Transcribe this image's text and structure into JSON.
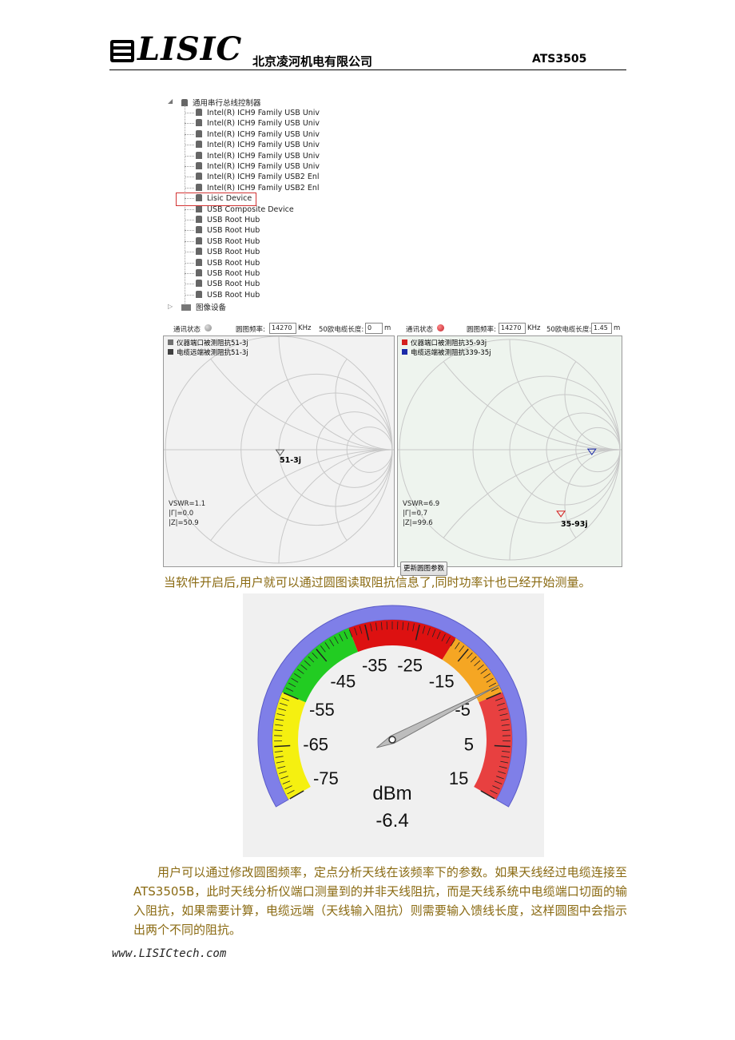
{
  "header": {
    "logo_text": "LISIC",
    "company": "北京凌河机电有限公司",
    "model": "ATS3505"
  },
  "device_tree": {
    "root_label": "通用串行总线控制器",
    "items": [
      "Intel(R) ICH9 Family USB Univ",
      "Intel(R) ICH9 Family USB Univ",
      "Intel(R) ICH9 Family USB Univ",
      "Intel(R) ICH9 Family USB Univ",
      "Intel(R) ICH9 Family USB Univ",
      "Intel(R) ICH9 Family USB Univ",
      "Intel(R) ICH9 Family USB2 Enl",
      "Intel(R) ICH9 Family USB2 Enl",
      "Lisic Device",
      "USB Composite Device",
      "USB Root Hub",
      "USB Root Hub",
      "USB Root Hub",
      "USB Root Hub",
      "USB Root Hub",
      "USB Root Hub",
      "USB Root Hub",
      "USB Root Hub"
    ],
    "selected_item": "Lisic Device",
    "next_group": "图像设备"
  },
  "smith_left": {
    "status_label": "通讯状态",
    "status_color": "#888888",
    "freq_label": "圆图频率:",
    "freq_value": "14270",
    "freq_unit": "KHz",
    "cable_label": "50欧电缆长度:",
    "cable_value": "0",
    "cable_unit": "m",
    "legend": [
      {
        "text": "仪器端口被测阻抗51-3j",
        "color": "#707070"
      },
      {
        "text": "电缆远端被测阻抗51-3j",
        "color": "#404040"
      }
    ],
    "marker_label": "51-3j",
    "vswr": "VSWR=1.1",
    "gamma": "|Γ|=0.0",
    "z": "|Z|=50.9"
  },
  "smith_right": {
    "status_label": "通讯状态",
    "status_color": "#c0202a",
    "freq_label": "圆图频率:",
    "freq_value": "14270",
    "freq_unit": "KHz",
    "cable_label": "50欧电缆长度:",
    "cable_value": "1.45",
    "cable_unit": "m",
    "legend": [
      {
        "text": "仪器端口被测阻抗35-93j",
        "color": "#d42020"
      },
      {
        "text": "电缆远端被测阻抗339-35j",
        "color": "#1a2aa8"
      }
    ],
    "marker_label": "35-93j",
    "vswr": "VSWR=6.9",
    "gamma": "|Γ|=0.7",
    "z": "|Z|=99.6",
    "update_button": "更新圆图参数"
  },
  "caption": "当软件开启后,用户就可以通过圆图读取阻抗信息了,同时功率计也已经开始测量。",
  "gauge": {
    "min": -75,
    "max": 15,
    "tick_labels": [
      "-75",
      "-65",
      "-55",
      "-45",
      "-35",
      "-25",
      "-15",
      "-5",
      "5",
      "15"
    ],
    "unit": "dBm",
    "value": -6.4,
    "value_text": "-6.4",
    "zones": [
      {
        "from": -75,
        "to": -55,
        "color": "#f5f010"
      },
      {
        "from": -55,
        "to": -38,
        "color": "#22cc22"
      },
      {
        "from": -38,
        "to": -18,
        "color": "#dd1111"
      },
      {
        "from": -18,
        "to": -5,
        "color": "#f5a623"
      },
      {
        "from": -5,
        "to": 15,
        "color": "#e84040"
      }
    ],
    "rim_color": "#7f7fe8"
  },
  "paragraph": "用户可以通过修改圆图频率，定点分析天线在该频率下的参数。如果天线经过电缆连接至 ATS3505B，此时天线分析仪端口测量到的并非天线阻抗，而是天线系统中电缆端口切面的输入阻抗，如果需要计算，电缆远端（天线输入阻抗）则需要输入馈线长度，这样圆图中会指示出两个不同的阻抗。",
  "footer": "www.LISICtech.com"
}
